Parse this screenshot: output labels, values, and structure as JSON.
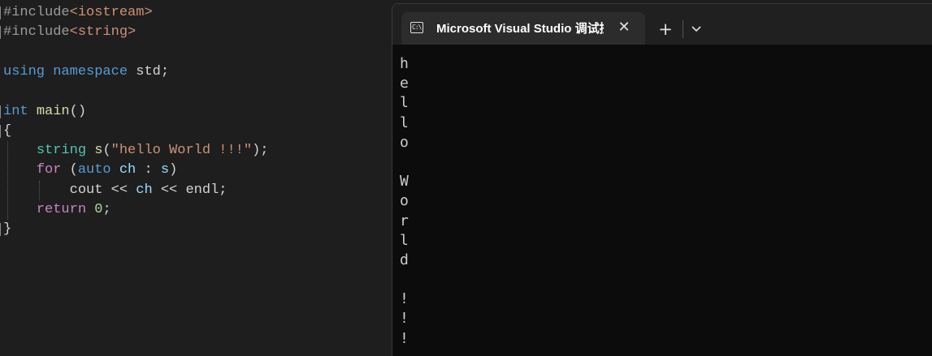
{
  "editor": {
    "lines": [
      [
        {
          "t": "#include",
          "c": "t-pre"
        },
        {
          "t": "<iostream>",
          "c": "t-inc"
        }
      ],
      [
        {
          "t": "#include",
          "c": "t-pre"
        },
        {
          "t": "<string>",
          "c": "t-inc"
        }
      ],
      [],
      [
        {
          "t": "using",
          "c": "t-kw"
        },
        {
          "t": " ",
          "c": "t-plain"
        },
        {
          "t": "namespace",
          "c": "t-kw"
        },
        {
          "t": " std;",
          "c": "t-plain"
        }
      ],
      [],
      [
        {
          "t": "int",
          "c": "t-kw"
        },
        {
          "t": " ",
          "c": "t-plain"
        },
        {
          "t": "main",
          "c": "t-fn"
        },
        {
          "t": "()",
          "c": "t-plain"
        }
      ],
      [
        {
          "t": "{",
          "c": "t-plain"
        }
      ],
      [
        {
          "t": "    ",
          "c": "t-plain"
        },
        {
          "t": "string",
          "c": "t-type"
        },
        {
          "t": " ",
          "c": "t-plain"
        },
        {
          "t": "s",
          "c": "t-fn"
        },
        {
          "t": "(",
          "c": "t-plain"
        },
        {
          "t": "\"hello World !!!\"",
          "c": "t-str"
        },
        {
          "t": ");",
          "c": "t-plain"
        }
      ],
      [
        {
          "t": "    ",
          "c": "t-plain"
        },
        {
          "t": "for",
          "c": "t-ctl"
        },
        {
          "t": " (",
          "c": "t-plain"
        },
        {
          "t": "auto",
          "c": "t-kw"
        },
        {
          "t": " ",
          "c": "t-plain"
        },
        {
          "t": "ch",
          "c": "t-var"
        },
        {
          "t": " : ",
          "c": "t-plain"
        },
        {
          "t": "s",
          "c": "t-var"
        },
        {
          "t": ")",
          "c": "t-plain"
        }
      ],
      [
        {
          "t": "        ",
          "c": "t-plain"
        },
        {
          "t": "cout",
          "c": "t-plain"
        },
        {
          "t": " << ",
          "c": "t-plain"
        },
        {
          "t": "ch",
          "c": "t-var"
        },
        {
          "t": " << ",
          "c": "t-plain"
        },
        {
          "t": "endl",
          "c": "t-plain"
        },
        {
          "t": ";",
          "c": "t-plain"
        }
      ],
      [
        {
          "t": "    ",
          "c": "t-plain"
        },
        {
          "t": "return",
          "c": "t-ctl"
        },
        {
          "t": " ",
          "c": "t-plain"
        },
        {
          "t": "0",
          "c": "t-num"
        },
        {
          "t": ";",
          "c": "t-plain"
        }
      ],
      [
        {
          "t": "}",
          "c": "t-plain"
        }
      ]
    ]
  },
  "terminal": {
    "tab_title": "Microsoft Visual Studio 调试控制台",
    "tab_icon_text": "C:\\",
    "close_glyph": "✕",
    "new_tab_glyph": "+",
    "output_lines": [
      "h",
      "e",
      "l",
      "l",
      "o",
      " ",
      "W",
      "o",
      "r",
      "l",
      "d",
      " ",
      "!",
      "!",
      "!"
    ]
  }
}
